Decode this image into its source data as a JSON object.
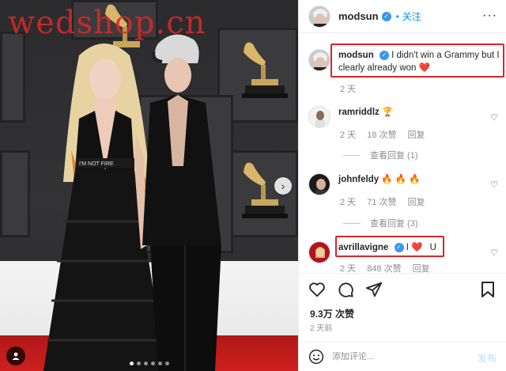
{
  "photo": {
    "watermark": "wedshop.cn",
    "next_arrow": "›",
    "carousel_total": 6,
    "carousel_active": 1,
    "shirt_print": "I'M NOT FIRE"
  },
  "header": {
    "username": "modsun",
    "verified_icon": "verified-badge-icon",
    "follow_label": "关注",
    "more_label": "···"
  },
  "caption": {
    "username": "modsun",
    "text": "I didn't win a Grammy but I clearly already won",
    "emoji": "❤️",
    "time": "2 天",
    "highlight_color": "#d9262b"
  },
  "comments": [
    {
      "username": "ramriddlz",
      "text": "🏆",
      "time": "2 天",
      "likes": "18 次赞",
      "reply": "回复",
      "view_replies": "查看回复 (1)"
    },
    {
      "username": "johnfeldy",
      "text": "🔥 🔥 🔥",
      "time": "2 天",
      "likes": "71 次赞",
      "reply": "回复",
      "view_replies": "查看回复 (3)"
    },
    {
      "username": "avrillavigne",
      "text_before": "I",
      "heart": "❤️",
      "text_after": "U",
      "time": "2 天",
      "likes": "848 次赞",
      "reply": "回复"
    }
  ],
  "actions": {
    "like_icon": "heart-outline-icon",
    "comment_icon": "comment-bubble-icon",
    "share_icon": "paper-plane-icon",
    "save_icon": "bookmark-icon"
  },
  "likes_count": "9.3万 次赞",
  "posted_ago": "2 天前",
  "composer": {
    "placeholder": "添加评论...",
    "post_label": "发布"
  },
  "colors": {
    "accent": "#0095f6",
    "verified": "#3897f0",
    "red_carpet": "#cf1f1f",
    "highlight": "#d9262b"
  }
}
